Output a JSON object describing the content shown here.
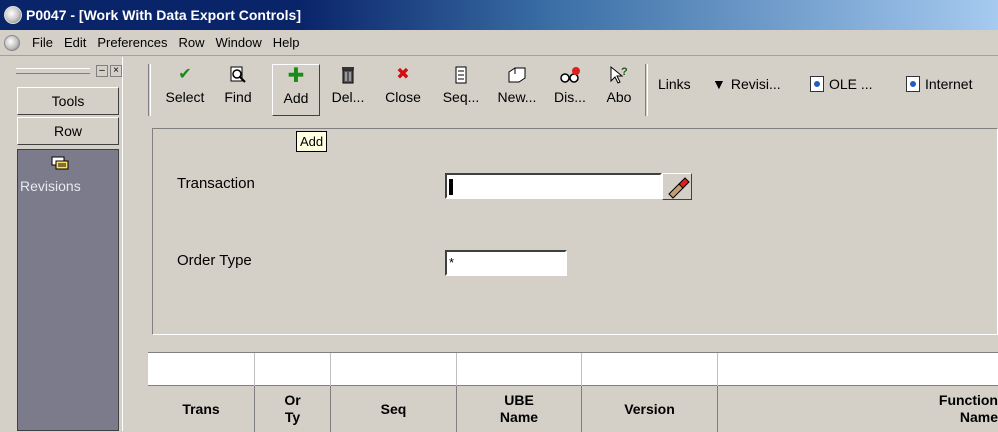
{
  "window": {
    "title": "P0047 - [Work With Data Export Controls]"
  },
  "menu": [
    "File",
    "Edit",
    "Preferences",
    "Row",
    "Window",
    "Help"
  ],
  "left_panel": {
    "header_controls": [
      "–",
      "×"
    ],
    "tools_label": "Tools",
    "row_label": "Row",
    "exit_label": "Revisions"
  },
  "toolbar": {
    "buttons": [
      {
        "label": "Select",
        "icon": "checkmark-icon",
        "glyph": "✔",
        "color": "#1a8a1a"
      },
      {
        "label": "Find",
        "icon": "find-icon",
        "glyph": "🔍",
        "color": "#000000"
      },
      {
        "label": "Add",
        "icon": "plus-icon",
        "glyph": "✚",
        "color": "#1a8a1a"
      },
      {
        "label": "Del...",
        "icon": "trash-icon",
        "glyph": "🗑",
        "color": "#000000"
      },
      {
        "label": "Close",
        "icon": "close-icon",
        "glyph": "✖",
        "color": "#d01010"
      },
      {
        "label": "Seq...",
        "icon": "sequence-icon",
        "glyph": "▤",
        "color": "#000000"
      },
      {
        "label": "New...",
        "icon": "new-icon",
        "glyph": "🗁",
        "color": "#000000"
      },
      {
        "label": "Dis...",
        "icon": "display-icon",
        "glyph": "⚙",
        "color": "#000000"
      },
      {
        "label": "Abo",
        "icon": "about-icon",
        "glyph": "?",
        "color": "#000000"
      }
    ],
    "links_label": "Links",
    "revisions_label": "Revisi...",
    "ole_label": "OLE ...",
    "internet_label": "Internet",
    "tooltip": "Add"
  },
  "form": {
    "transaction_label": "Transaction",
    "transaction_value": "",
    "order_type_label": "Order Type",
    "order_type_value": "*"
  },
  "grid": {
    "columns": [
      "Trans",
      "Or Ty",
      "Seq",
      "UBE Name",
      "Version",
      "Function Name"
    ]
  }
}
